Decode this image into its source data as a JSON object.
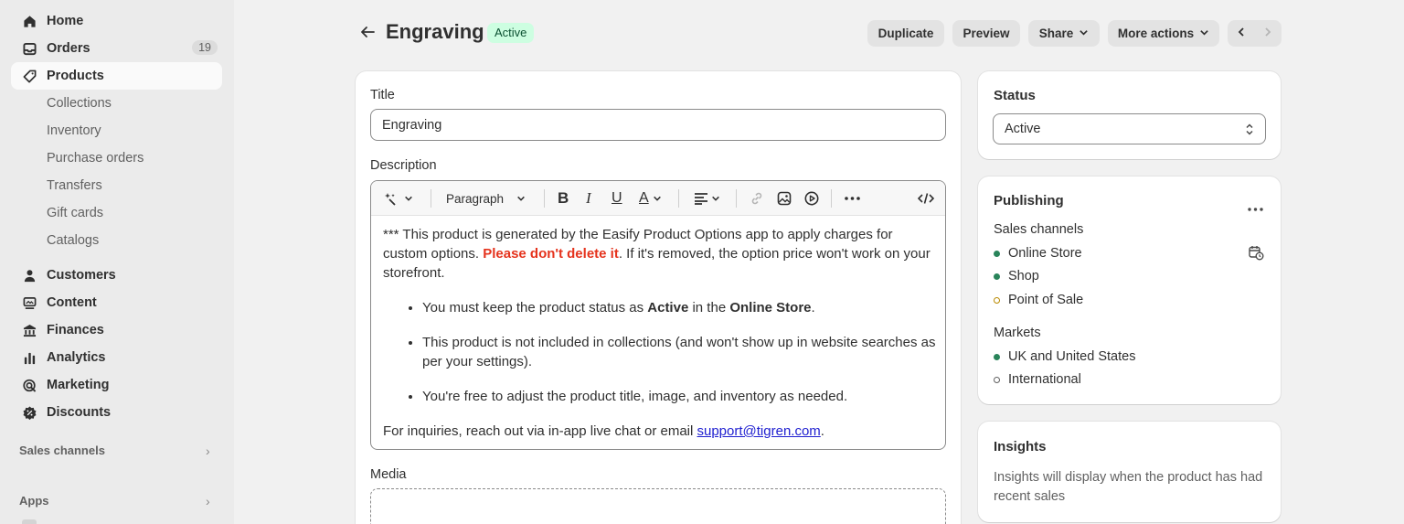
{
  "sidebar": {
    "items": [
      {
        "label": "Home",
        "icon": "home-icon"
      },
      {
        "label": "Orders",
        "icon": "inbox-icon",
        "count": "19"
      },
      {
        "label": "Products",
        "icon": "tag-icon"
      },
      {
        "label": "Customers",
        "icon": "person-icon"
      },
      {
        "label": "Content",
        "icon": "content-icon"
      },
      {
        "label": "Finances",
        "icon": "bank-icon"
      },
      {
        "label": "Analytics",
        "icon": "bar-chart-icon"
      },
      {
        "label": "Marketing",
        "icon": "target-icon"
      },
      {
        "label": "Discounts",
        "icon": "discount-icon"
      }
    ],
    "product_sub": [
      "Collections",
      "Inventory",
      "Purchase orders",
      "Transfers",
      "Gift cards",
      "Catalogs"
    ],
    "sales_channels": "Sales channels",
    "apps": "Apps"
  },
  "header": {
    "title": "Engraving",
    "status": "Active",
    "duplicate": "Duplicate",
    "preview": "Preview",
    "share": "Share",
    "more_actions": "More actions"
  },
  "main": {
    "title_label": "Title",
    "title_value": "Engraving",
    "description_label": "Description",
    "toolbar_paragraph": "Paragraph",
    "desc_p1_a": "*** This product is generated by the Easify Product Options app to apply charges for custom options. ",
    "desc_p1_red": "Please don't delete it",
    "desc_p1_b": ". If it's removed, the option price won't work on your storefront.",
    "bullet1_a": "You must keep the product status as ",
    "bullet1_b1": "Active",
    "bullet1_c": " in the ",
    "bullet1_b2": "Online Store",
    "bullet1_d": ".",
    "bullet2": "This product is not included in collections (and won't show up in website searches as per your settings).",
    "bullet3": "You're free to adjust the product title, image, and inventory as needed.",
    "desc_p2_a": "For inquiries, reach out via in-app live chat or email ",
    "desc_p2_link": "support@tigren.com",
    "desc_p2_b": ".",
    "media_label": "Media"
  },
  "status_card": {
    "heading": "Status",
    "value": "Active"
  },
  "publishing": {
    "heading": "Publishing",
    "sales_channels_label": "Sales channels",
    "channels": [
      {
        "name": "Online Store",
        "state": "green"
      },
      {
        "name": "Shop",
        "state": "green"
      },
      {
        "name": "Point of Sale",
        "state": "orange"
      }
    ],
    "markets_label": "Markets",
    "markets": [
      {
        "name": "UK and United States",
        "state": "green"
      },
      {
        "name": "International",
        "state": "empty"
      }
    ]
  },
  "insights": {
    "heading": "Insights",
    "text": "Insights will display when the product has had recent sales"
  },
  "colors": {
    "accent_green": "#29845a",
    "badge_bg": "#cdfee1",
    "warning_red": "#e5331d"
  }
}
